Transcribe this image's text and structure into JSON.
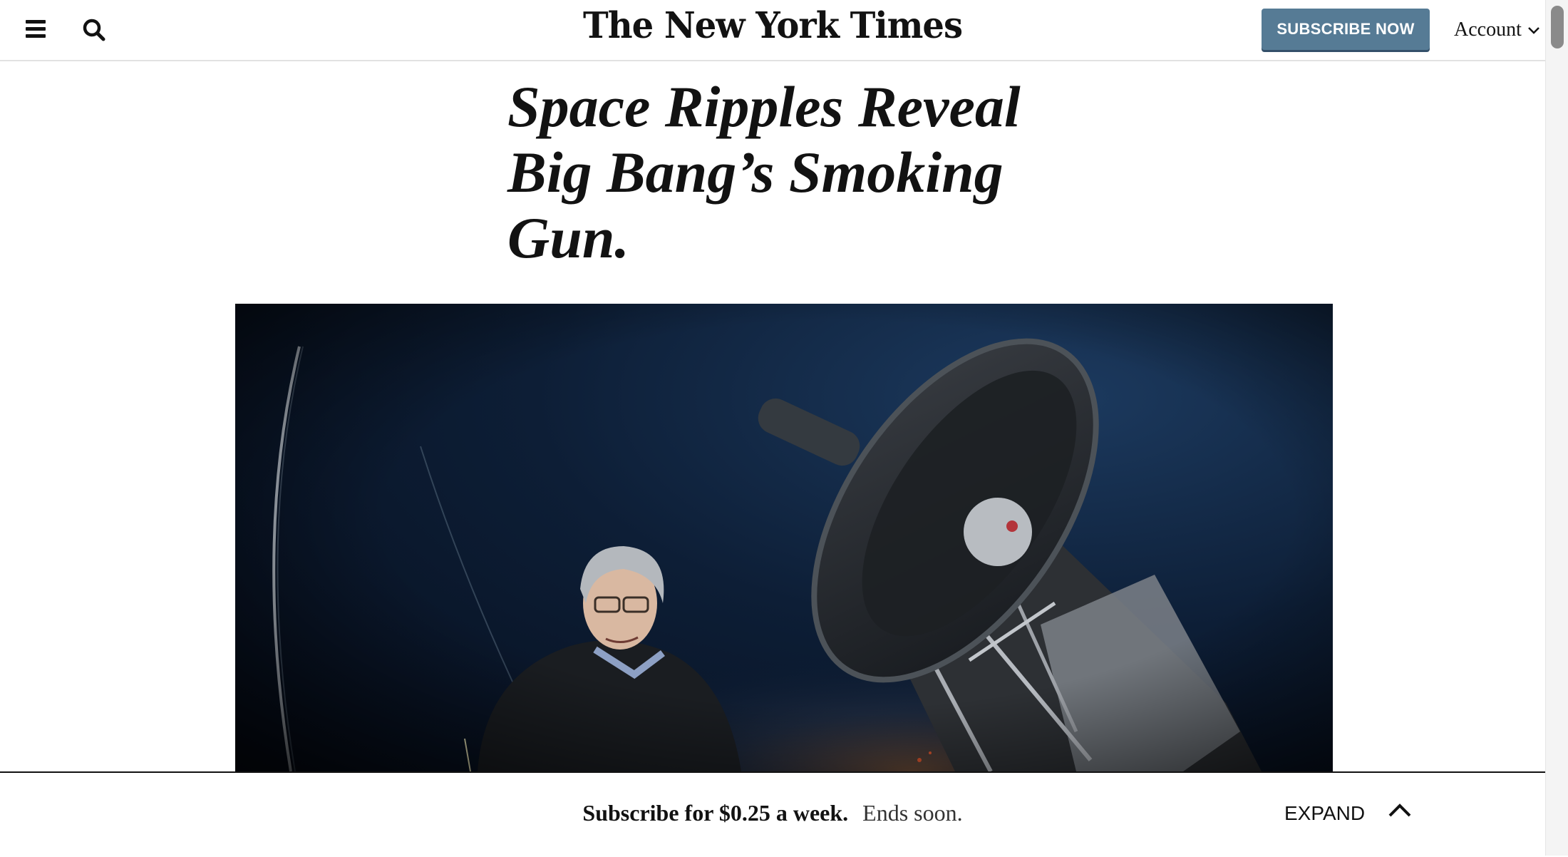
{
  "header": {
    "logo_text": "The New York Times",
    "subscribe_label": "SUBSCRIBE NOW",
    "account_label": "Account",
    "subscribe_color": "#567b95"
  },
  "article": {
    "headline": "Space Ripples Reveal Big Bang’s Smoking Gun."
  },
  "bottom_bar": {
    "offer_strong": "Subscribe for $0.25 a week.",
    "offer_rest": "Ends soon.",
    "expand_label": "EXPAND"
  },
  "icons": [
    "hamburger-menu-icon",
    "search-icon",
    "chevron-down-icon",
    "chevron-up-icon"
  ]
}
